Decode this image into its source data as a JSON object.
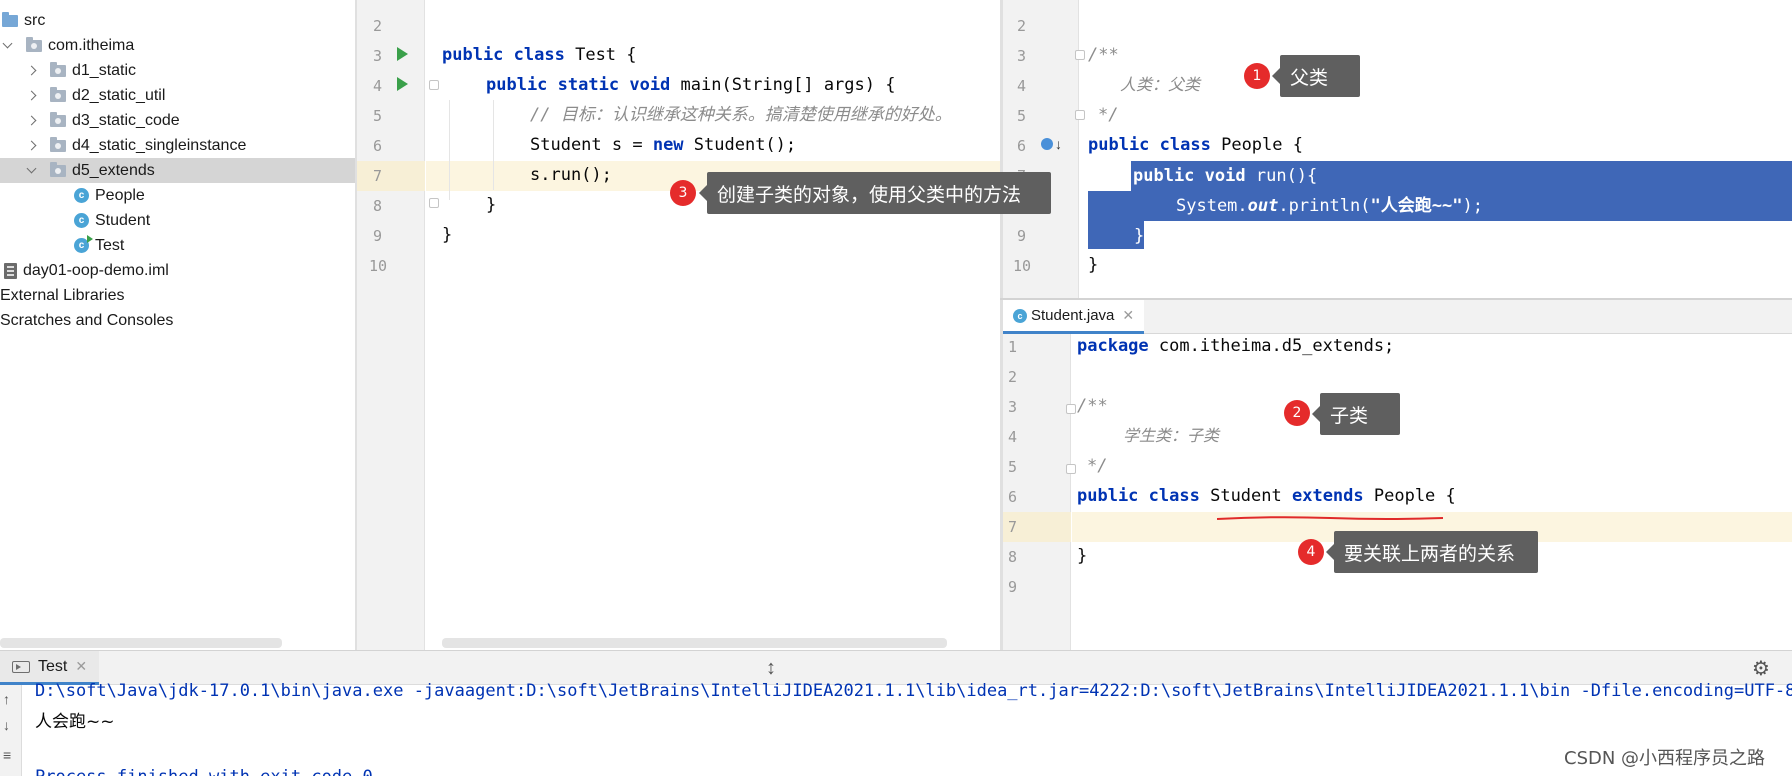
{
  "project_tree": [
    {
      "label": "src",
      "depth": 0,
      "kind": "src-folder",
      "chevron": "none"
    },
    {
      "label": "com.itheima",
      "depth": 0,
      "kind": "package",
      "chevron": "down"
    },
    {
      "label": "d1_static",
      "depth": 1,
      "kind": "package",
      "chevron": "right"
    },
    {
      "label": "d2_static_util",
      "depth": 1,
      "kind": "package",
      "chevron": "right"
    },
    {
      "label": "d3_static_code",
      "depth": 1,
      "kind": "package",
      "chevron": "right"
    },
    {
      "label": "d4_static_singleinstance",
      "depth": 1,
      "kind": "package",
      "chevron": "right"
    },
    {
      "label": "d5_extends",
      "depth": 1,
      "kind": "package",
      "chevron": "down",
      "selected": true
    },
    {
      "label": "People",
      "depth": 2,
      "kind": "class"
    },
    {
      "label": "Student",
      "depth": 2,
      "kind": "class"
    },
    {
      "label": "Test",
      "depth": 2,
      "kind": "runnable-class"
    },
    {
      "label": "day01-oop-demo.iml",
      "depth": -1,
      "kind": "iml"
    },
    {
      "label": "External Libraries",
      "depth": -2,
      "kind": "none"
    },
    {
      "label": "Scratches and Consoles",
      "depth": -2,
      "kind": "none"
    }
  ],
  "editor_test": {
    "line_numbers": [
      "2",
      "3",
      "4",
      "5",
      "6",
      "7",
      "8",
      "9",
      "10"
    ],
    "lines": {
      "l3": {
        "kw1": "public",
        "kw2": "class",
        "rest": " Test {"
      },
      "l4": {
        "kw1": "public",
        "kw2": "static",
        "kw3": "void",
        "rest": " main(String[] args) {"
      },
      "l5": {
        "comment": "// 目标：认识继承这种关系。搞清楚使用继承的好处。"
      },
      "l6": {
        "a": "Student s = ",
        "kw": "new",
        "b": " Student();"
      },
      "l7": {
        "text": "s.run();"
      },
      "l8": {
        "text": "}"
      },
      "l9": {
        "text": "}"
      }
    }
  },
  "editor_people": {
    "line_numbers": [
      "2",
      "3",
      "4",
      "5",
      "6",
      "7",
      "8",
      "9",
      "10"
    ],
    "lines": {
      "l3": {
        "comment": "/**"
      },
      "l4": {
        "comment": "人类：父类"
      },
      "l5": {
        "comment": "*/"
      },
      "l6": {
        "kw1": "public",
        "kw2": "class",
        "rest": " People {"
      },
      "l7": {
        "kw1": "public",
        "kw2": "void",
        "rest": " run(){"
      },
      "l8": {
        "a": "System.",
        "it": "out",
        "b": ".println(",
        "str": "\"人会跑~~\"",
        "c": ");"
      },
      "l9": {
        "text": "}"
      },
      "l10": {
        "text": "}"
      }
    }
  },
  "student_tab": {
    "label": "Student.java"
  },
  "editor_student": {
    "line_numbers": [
      "1",
      "2",
      "3",
      "4",
      "5",
      "6",
      "7",
      "8",
      "9"
    ],
    "lines": {
      "l1": {
        "kw": "package",
        "rest": " com.itheima.d5_extends;"
      },
      "l3": {
        "comment": "/**"
      },
      "l4": {
        "comment": "学生类：子类"
      },
      "l5": {
        "comment": "*/"
      },
      "l6": {
        "kw1": "public",
        "kw2": "class",
        "a": " Student ",
        "kw3": "extends",
        "b": " People {"
      },
      "l8": {
        "text": "}"
      }
    }
  },
  "callouts": [
    {
      "num": "1",
      "text": "父类"
    },
    {
      "num": "2",
      "text": "子类"
    },
    {
      "num": "3",
      "text": "创建子类的对象，使用父类中的方法"
    },
    {
      "num": "4",
      "text": "要关联上两者的关系"
    }
  ],
  "run_panel": {
    "tab_label": "Test",
    "command": "D:\\soft\\Java\\jdk-17.0.1\\bin\\java.exe -javaagent:D:\\soft\\JetBrains\\IntelliJIDEA2021.1.1\\lib\\idea_rt.jar=4222:D:\\soft\\JetBrains\\IntelliJIDEA2021.1.1\\bin -Dfile.encoding=UTF-8",
    "output": "人会跑~~",
    "exit": "Process finished with exit code 0"
  },
  "watermark": "CSDN @小西程序员之路",
  "colors": {
    "keyword": "#0033b3",
    "string": "#067d17",
    "selection": "#3f67b7",
    "badge": "#e52b2b",
    "callout": "#5f5f5f"
  }
}
